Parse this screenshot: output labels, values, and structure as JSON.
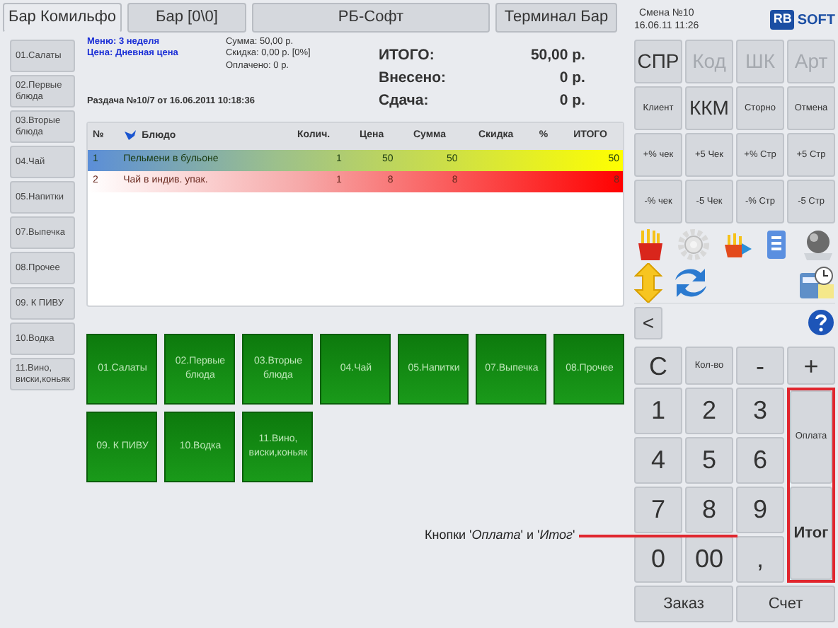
{
  "tabs": [
    {
      "label": "Бар Комильфо",
      "selected": true
    },
    {
      "label": "Бар [0\\0]",
      "selected": false
    },
    {
      "label": "РБ-Софт",
      "selected": false
    },
    {
      "label": "Терминал Бар",
      "selected": false
    }
  ],
  "shift": {
    "title": "Смена №10",
    "datetime": "16.06.11 11:26"
  },
  "logo": {
    "mark": "RB",
    "text": "SOFT"
  },
  "categories": [
    "01.Салаты",
    "02.Первые блюда",
    "03.Вторые блюда",
    "04.Чай",
    "05.Напитки",
    "07.Выпечка",
    "08.Прочее",
    "09. К ПИВУ",
    "10.Водка",
    "11.Вино, виски,коньяк"
  ],
  "order_info": {
    "menu": "Меню: 3 неделя",
    "price": "Цена: Дневная цена",
    "sum": "Сумма: 50,00 р.",
    "discount": "Скидка: 0,00 р. [0%]",
    "paid": "Оплачено: 0 р.",
    "dispatch": "Раздача №10/7 от 16.06.2011 10:18:36"
  },
  "totals": [
    {
      "label": "ИТОГО:",
      "value": "50,00 р."
    },
    {
      "label": "Внесено:",
      "value": "0 р."
    },
    {
      "label": "Сдача:",
      "value": "0 р."
    }
  ],
  "table": {
    "columns": [
      "№",
      "Блюдо",
      "Колич.",
      "Цена",
      "Сумма",
      "Скидка",
      "%",
      "ИТОГО"
    ],
    "rows": [
      {
        "cells": [
          "1",
          "Пельмени в бульоне",
          "1",
          "50",
          "50",
          "",
          "",
          "50"
        ],
        "selected": true,
        "color": "#ffff00"
      },
      {
        "cells": [
          "2",
          "Чай в индив. упак.",
          "1",
          "8",
          "8",
          "",
          "",
          "8"
        ],
        "selected": false,
        "color": "#ff0000"
      }
    ]
  },
  "tiles": [
    "01.Салаты",
    "02.Первые блюда",
    "03.Вторые блюда",
    "04.Чай",
    "05.Напитки",
    "07.Выпечка",
    "08.Прочее",
    "09. К ПИВУ",
    "10.Водка",
    "11.Вино, виски,коньяк"
  ],
  "function_buttons": [
    {
      "label": "СПР",
      "disabled": false,
      "kind": "big"
    },
    {
      "label": "Код",
      "disabled": true,
      "kind": "big"
    },
    {
      "label": "ШК",
      "disabled": true,
      "kind": "big"
    },
    {
      "label": "Арт",
      "disabled": true,
      "kind": "big"
    },
    {
      "label": "Клиент",
      "disabled": false,
      "kind": "small"
    },
    {
      "label": "ККМ",
      "disabled": false,
      "kind": "big"
    },
    {
      "label": "Сторно",
      "disabled": false,
      "kind": "small"
    },
    {
      "label": "Отмена",
      "disabled": false,
      "kind": "small"
    },
    {
      "label": "+% чек",
      "disabled": false,
      "kind": "small"
    },
    {
      "label": "+5 Чек",
      "disabled": false,
      "kind": "small"
    },
    {
      "label": "+% Стр",
      "disabled": false,
      "kind": "small"
    },
    {
      "label": "+5 Стр",
      "disabled": false,
      "kind": "small"
    },
    {
      "label": "-% чек",
      "disabled": false,
      "kind": "small"
    },
    {
      "label": "-5 Чек",
      "disabled": false,
      "kind": "small"
    },
    {
      "label": "-% Стр",
      "disabled": false,
      "kind": "small"
    },
    {
      "label": "-5 Стр",
      "disabled": false,
      "kind": "small"
    }
  ],
  "back_button": "<",
  "keypad": [
    {
      "label": "C",
      "kind": "digit",
      "highlighted": false
    },
    {
      "label": "Кол-во",
      "kind": "text",
      "highlighted": false
    },
    {
      "label": "-",
      "kind": "digit",
      "highlighted": false
    },
    {
      "label": "+",
      "kind": "digit",
      "highlighted": false
    },
    {
      "label": "1",
      "kind": "digit",
      "highlighted": false
    },
    {
      "label": "2",
      "kind": "digit",
      "highlighted": false
    },
    {
      "label": "3",
      "kind": "digit",
      "highlighted": false
    },
    {
      "label": "Оплата",
      "kind": "text",
      "highlighted": true
    },
    {
      "label": "4",
      "kind": "digit",
      "highlighted": false
    },
    {
      "label": "5",
      "kind": "digit",
      "highlighted": false
    },
    {
      "label": "6",
      "kind": "digit",
      "highlighted": false
    },
    {
      "label": "7",
      "kind": "digit",
      "highlighted": false
    },
    {
      "label": "8",
      "kind": "digit",
      "highlighted": false
    },
    {
      "label": "9",
      "kind": "digit",
      "highlighted": false
    },
    {
      "label": "Итог",
      "kind": "total",
      "highlighted": true
    },
    {
      "label": "0",
      "kind": "digit",
      "highlighted": false
    },
    {
      "label": "00",
      "kind": "digit",
      "highlighted": false
    },
    {
      "label": ",",
      "kind": "digit",
      "highlighted": false
    },
    {
      "label": "Заказ",
      "kind": "wide",
      "highlighted": false
    },
    {
      "label": "Счет",
      "kind": "wide",
      "highlighted": false
    }
  ],
  "annotation": "Кнопки '*Оплата*' и '*Итог*'"
}
